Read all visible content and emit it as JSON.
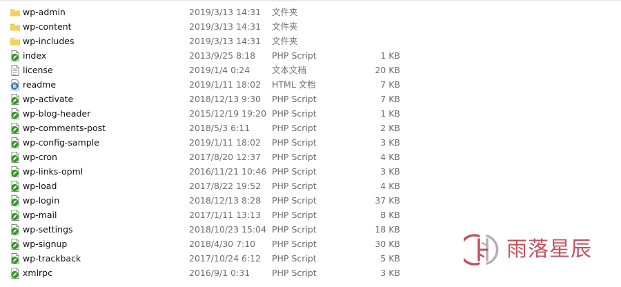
{
  "files": [
    {
      "icon": "folder-icon",
      "name": "wp-admin",
      "date": "2019/3/13 14:31",
      "type": "文件夹",
      "size": ""
    },
    {
      "icon": "folder-icon",
      "name": "wp-content",
      "date": "2019/3/13 14:31",
      "type": "文件夹",
      "size": ""
    },
    {
      "icon": "folder-icon",
      "name": "wp-includes",
      "date": "2019/3/13 14:31",
      "type": "文件夹",
      "size": ""
    },
    {
      "icon": "php-file-icon",
      "name": "index",
      "date": "2013/9/25 8:18",
      "type": "PHP Script",
      "size": "1 KB"
    },
    {
      "icon": "text-file-icon",
      "name": "license",
      "date": "2019/1/4 0:24",
      "type": "文本文档",
      "size": "20 KB"
    },
    {
      "icon": "html-file-icon",
      "name": "readme",
      "date": "2019/1/11 18:02",
      "type": "HTML 文档",
      "size": "7 KB"
    },
    {
      "icon": "php-file-icon",
      "name": "wp-activate",
      "date": "2018/12/13 9:30",
      "type": "PHP Script",
      "size": "7 KB"
    },
    {
      "icon": "php-file-icon",
      "name": "wp-blog-header",
      "date": "2015/12/19 19:20",
      "type": "PHP Script",
      "size": "1 KB"
    },
    {
      "icon": "php-file-icon",
      "name": "wp-comments-post",
      "date": "2018/5/3 6:11",
      "type": "PHP Script",
      "size": "2 KB"
    },
    {
      "icon": "php-file-icon",
      "name": "wp-config-sample",
      "date": "2019/1/11 18:02",
      "type": "PHP Script",
      "size": "3 KB"
    },
    {
      "icon": "php-file-icon",
      "name": "wp-cron",
      "date": "2017/8/20 12:37",
      "type": "PHP Script",
      "size": "4 KB"
    },
    {
      "icon": "php-file-icon",
      "name": "wp-links-opml",
      "date": "2016/11/21 10:46",
      "type": "PHP Script",
      "size": "3 KB"
    },
    {
      "icon": "php-file-icon",
      "name": "wp-load",
      "date": "2017/8/22 19:52",
      "type": "PHP Script",
      "size": "4 KB"
    },
    {
      "icon": "php-file-icon",
      "name": "wp-login",
      "date": "2018/12/13 8:28",
      "type": "PHP Script",
      "size": "37 KB"
    },
    {
      "icon": "php-file-icon",
      "name": "wp-mail",
      "date": "2017/1/11 13:13",
      "type": "PHP Script",
      "size": "8 KB"
    },
    {
      "icon": "php-file-icon",
      "name": "wp-settings",
      "date": "2018/10/23 15:04",
      "type": "PHP Script",
      "size": "18 KB"
    },
    {
      "icon": "php-file-icon",
      "name": "wp-signup",
      "date": "2018/4/30 7:10",
      "type": "PHP Script",
      "size": "30 KB"
    },
    {
      "icon": "php-file-icon",
      "name": "wp-trackback",
      "date": "2017/10/24 6:12",
      "type": "PHP Script",
      "size": "5 KB"
    },
    {
      "icon": "php-file-icon",
      "name": "xmlrpc",
      "date": "2016/9/1 0:31",
      "type": "PHP Script",
      "size": "3 KB"
    }
  ],
  "watermark": {
    "text": "雨落星辰",
    "color": "#c8505b",
    "logo_icon": "yuluo-logo-icon"
  },
  "colors": {
    "folder": "#f6cf5d",
    "php_leaf": "#2f9e1f",
    "html_e": "#1b73c7",
    "meta_text": "#6d6d6d"
  }
}
